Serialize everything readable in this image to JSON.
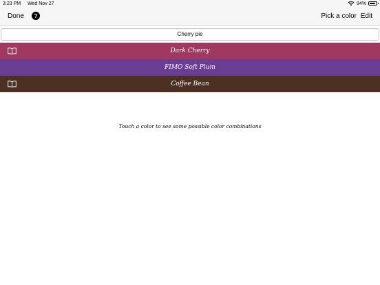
{
  "status_bar": {
    "time": "3:23 PM",
    "date": "Wed Nov 27",
    "battery_percent": "94%",
    "battery_level": 0.94
  },
  "nav": {
    "done_label": "Done",
    "help_label": "?",
    "pick_color_label": "Pick a color",
    "edit_label": "Edit"
  },
  "search": {
    "value": "Cherry pie"
  },
  "colors": [
    {
      "name": "Dark Cherry",
      "hex": "#a0385f",
      "has_book_icon": true
    },
    {
      "name": "FIMO Soft Plum",
      "hex": "#6a3e93",
      "has_book_icon": false
    },
    {
      "name": "Coffee Bean",
      "hex": "#4b3023",
      "has_book_icon": true
    }
  ],
  "hint": "Touch a color to see some possible color combinations"
}
